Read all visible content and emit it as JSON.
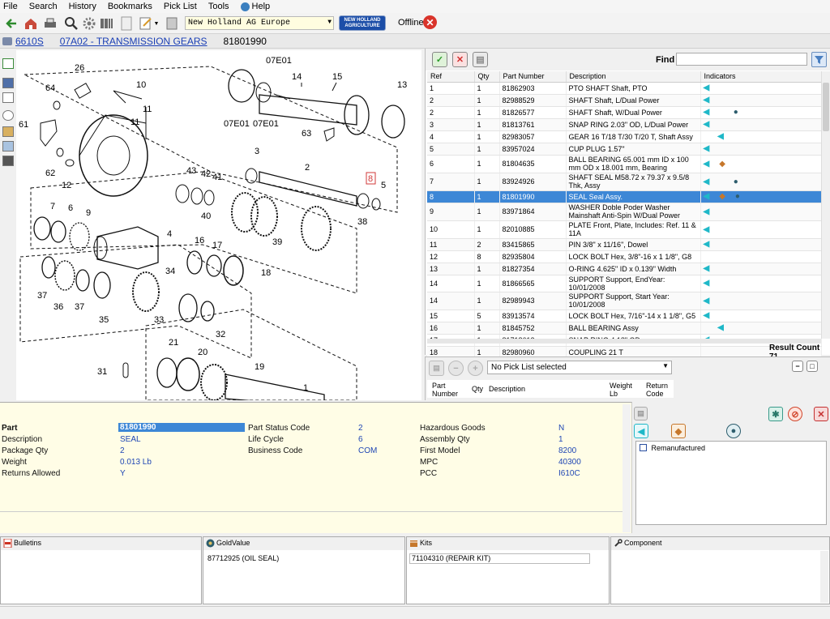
{
  "menu": [
    "File",
    "Search",
    "History",
    "Bookmarks",
    "Pick List",
    "Tools",
    "Help"
  ],
  "toolbar": {
    "catalog": "New Holland AG Europe",
    "brand_logo": "NEW HOLLAND AGRICULTURE",
    "offline_label": "Offline"
  },
  "breadcrumb": {
    "model": "6610S",
    "section": "07A02 - TRANSMISSION GEARS",
    "part": "81801990"
  },
  "diagram": {
    "labels": [
      "26",
      "64",
      "61",
      "62",
      "12",
      "10",
      "11",
      "11",
      "07E01",
      "07E01",
      "07E01",
      "14",
      "15",
      "13",
      "63",
      "3",
      "2",
      "8",
      "5",
      "43",
      "42",
      "41",
      "40",
      "38",
      "39",
      "7",
      "6",
      "9",
      "4",
      "16",
      "17",
      "18",
      "34",
      "37",
      "36",
      "37",
      "35",
      "33",
      "32",
      "21",
      "20",
      "19",
      "31",
      "1"
    ],
    "highlighted_label": "8"
  },
  "parts": {
    "find_label": "Find",
    "find_value": "",
    "columns": [
      "Ref",
      "Qty",
      "Part Number",
      "Description",
      "Indicators"
    ],
    "rows": [
      {
        "ref": "1",
        "qty": "1",
        "part": "81862903",
        "desc": "PTO SHAFT Shaft, PTO",
        "ind": [
          "arrow"
        ]
      },
      {
        "ref": "2",
        "qty": "1",
        "part": "82988529",
        "desc": "SHAFT Shaft, L/Dual Power",
        "ind": [
          "arrow"
        ]
      },
      {
        "ref": "2",
        "qty": "1",
        "part": "81826577",
        "desc": "SHAFT Shaft, W/Dual Power",
        "ind": [
          "arrow",
          "",
          "globe"
        ]
      },
      {
        "ref": "3",
        "qty": "1",
        "part": "81813761",
        "desc": "SNAP RING 2.03\" OD, L/Dual Power",
        "ind": [
          "arrow"
        ]
      },
      {
        "ref": "4",
        "qty": "1",
        "part": "82983057",
        "desc": "GEAR 16 T/18 T/30 T/20 T, Shaft Assy",
        "ind": [
          "",
          "arrow"
        ]
      },
      {
        "ref": "5",
        "qty": "1",
        "part": "83957024",
        "desc": "CUP PLUG 1.57\"",
        "ind": [
          "arrow"
        ]
      },
      {
        "ref": "6",
        "qty": "1",
        "part": "81804635",
        "desc": "BALL BEARING 65.001 mm  ID x 100 mm OD    x 18.001 mm, Bearing",
        "ind": [
          "arrow",
          "box"
        ]
      },
      {
        "ref": "7",
        "qty": "1",
        "part": "83924926",
        "desc": "SHAFT SEAL M58.72 x 79.37 x 9.5/8 Thk, Assy",
        "ind": [
          "arrow",
          "",
          "globe"
        ]
      },
      {
        "ref": "8",
        "qty": "1",
        "part": "81801990",
        "desc": "SEAL Seal Assy.",
        "ind": [
          "arrow",
          "box",
          "globe"
        ],
        "selected": true
      },
      {
        "ref": "9",
        "qty": "1",
        "part": "83971864",
        "desc": "WASHER Doble Poder Washer Mainshaft Anti-Spin W/Dual Power",
        "ind": [
          "arrow"
        ]
      },
      {
        "ref": "10",
        "qty": "1",
        "part": "82010885",
        "desc": "PLATE Front, Plate, Includes: Ref. 11 & 11A",
        "ind": [
          "arrow"
        ]
      },
      {
        "ref": "11",
        "qty": "2",
        "part": "83415865",
        "desc": "PIN 3/8\" x 11/16\", Dowel",
        "ind": [
          "arrow"
        ]
      },
      {
        "ref": "12",
        "qty": "8",
        "part": "82935804",
        "desc": "LOCK BOLT Hex, 3/8\"-16 x 1 1/8\", G8",
        "ind": []
      },
      {
        "ref": "13",
        "qty": "1",
        "part": "81827354",
        "desc": "O-RING 4.625\" ID x 0.139\" Width",
        "ind": [
          "arrow"
        ]
      },
      {
        "ref": "14",
        "qty": "1",
        "part": "81866565",
        "desc": "SUPPORT Support, EndYear: 10/01/2008",
        "ind": [
          "arrow"
        ]
      },
      {
        "ref": "14",
        "qty": "1",
        "part": "82989943",
        "desc": "SUPPORT Support, Start Year: 10/01/2008",
        "ind": [
          "arrow"
        ]
      },
      {
        "ref": "15",
        "qty": "5",
        "part": "83913574",
        "desc": "LOCK BOLT Hex, 7/16\"-14 x 1 1/8\", G5",
        "ind": [
          "arrow"
        ]
      },
      {
        "ref": "16",
        "qty": "1",
        "part": "81845752",
        "desc": "BALL BEARING Assy",
        "ind": [
          "",
          "arrow"
        ]
      },
      {
        "ref": "17",
        "qty": "1",
        "part": "81718612",
        "desc": "SNAP RING 4.18\" OD",
        "ind": [
          "arrow"
        ]
      },
      {
        "ref": "18",
        "qty": "1",
        "part": "82980960",
        "desc": "COUPLING 21 T",
        "ind": []
      }
    ],
    "result_count": "Result Count  71"
  },
  "picklist": {
    "selected": "No Pick List selected",
    "columns": [
      "Part Number",
      "Qty",
      "Description",
      "Weight Lb",
      "Return Code"
    ]
  },
  "detail": {
    "part_label": "Part",
    "part": "81801990",
    "description_label": "Description",
    "description": "SEAL",
    "package_qty_label": "Package Qty",
    "package_qty": "2",
    "weight_label": "Weight",
    "weight": "0.013 Lb",
    "returns_allowed_label": "Returns Allowed",
    "returns_allowed": "Y",
    "part_status_code_label": "Part Status Code",
    "part_status_code": "2",
    "life_cycle_label": "Life Cycle",
    "life_cycle": "6",
    "business_code_label": "Business Code",
    "business_code": "COM",
    "hazardous_goods_label": "Hazardous Goods",
    "hazardous_goods": "N",
    "assembly_qty_label": "Assembly Qty",
    "assembly_qty": "1",
    "first_model_label": "First Model",
    "first_model": "8200",
    "mpc_label": "MPC",
    "mpc": "40300",
    "pcc_label": "PCC",
    "pcc": "I610C"
  },
  "right_detail": {
    "remanufactured_label": "Remanufactured"
  },
  "bottom": {
    "bulletins_title": "Bulletins",
    "goldvalue_title": "GoldValue",
    "goldvalue_item": "87712925 (OIL SEAL)",
    "kits_title": "Kits",
    "kits_item": "71104310 (REPAIR KIT)",
    "component_title": "Component"
  },
  "colors": {
    "selection": "#3d87d6",
    "link": "#1a3fb5",
    "detail_bg": "#fffde6",
    "indicator_arrow": "#1fb8c8"
  }
}
